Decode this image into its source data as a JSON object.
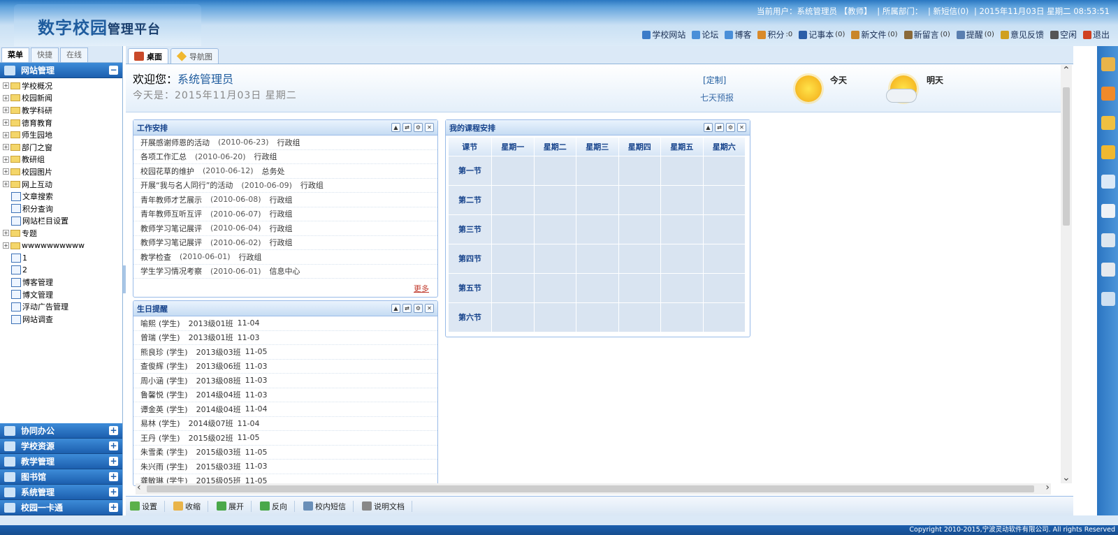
{
  "header": {
    "logo_main": "数字校园",
    "logo_sub": "管理平台",
    "user_label": "当前用户：系统管理员 【教师】",
    "dept_label": "| 所属部门：",
    "sms_label": "| 新短信(0)",
    "datetime": "| 2015年11月03日 星期二 08:53:51",
    "toolbar": [
      {
        "label": "学校网站",
        "count": "",
        "icon": "website-icon",
        "color": "#3b7bc8"
      },
      {
        "label": "论坛",
        "count": "",
        "icon": "forum-icon",
        "color": "#4a8fd8"
      },
      {
        "label": "博客",
        "count": "",
        "icon": "blog-icon",
        "color": "#4a8fd8"
      },
      {
        "label": "积分",
        "count": ":0",
        "icon": "points-icon",
        "color": "#d98a2a"
      },
      {
        "label": "记事本",
        "count": "(0)",
        "icon": "notebook-icon",
        "color": "#2a5ea8"
      },
      {
        "label": "新文件",
        "count": "(0)",
        "icon": "file-icon",
        "color": "#c9862a"
      },
      {
        "label": "新留言",
        "count": "(0)",
        "icon": "message-icon",
        "color": "#8a6a3a"
      },
      {
        "label": "提醒",
        "count": "(0)",
        "icon": "reminder-icon",
        "color": "#5a7fb0"
      },
      {
        "label": "意见反馈",
        "count": "",
        "icon": "feedback-icon",
        "color": "#d0a020"
      },
      {
        "label": "空闲",
        "count": "",
        "icon": "idle-icon",
        "color": "#555"
      },
      {
        "label": "退出",
        "count": "",
        "icon": "logout-icon",
        "color": "#d04020"
      }
    ]
  },
  "left": {
    "tabs": [
      "菜单",
      "快捷",
      "在线"
    ],
    "section_top": "网站管理",
    "tree": [
      {
        "label": "学校概况",
        "type": "folder"
      },
      {
        "label": "校园新闻",
        "type": "folder"
      },
      {
        "label": "教学科研",
        "type": "folder"
      },
      {
        "label": "德育教育",
        "type": "folder"
      },
      {
        "label": "师生园地",
        "type": "folder"
      },
      {
        "label": "部门之窗",
        "type": "folder"
      },
      {
        "label": "教研组",
        "type": "folder"
      },
      {
        "label": "校园图片",
        "type": "folder"
      },
      {
        "label": "网上互动",
        "type": "folder"
      },
      {
        "label": "文章搜索",
        "type": "doc"
      },
      {
        "label": "积分查询",
        "type": "doc"
      },
      {
        "label": "网站栏目设置",
        "type": "doc"
      },
      {
        "label": "专题",
        "type": "folder"
      },
      {
        "label": "wwwwwwwwww",
        "type": "folder"
      },
      {
        "label": "1",
        "type": "doc"
      },
      {
        "label": "2",
        "type": "doc"
      },
      {
        "label": "博客管理",
        "type": "doc"
      },
      {
        "label": "博文管理",
        "type": "doc"
      },
      {
        "label": "浮动广告管理",
        "type": "doc"
      },
      {
        "label": "网站调查",
        "type": "doc"
      }
    ],
    "sections_bottom": [
      "协同办公",
      "学校资源",
      "教学管理",
      "图书馆",
      "系统管理",
      "校园一卡通"
    ]
  },
  "main": {
    "tabs": [
      "桌面",
      "导航图"
    ],
    "welcome_prefix": "欢迎您：",
    "welcome_name": "系统管理员",
    "today_text": "今天是：2015年11月03日 星期二",
    "custom": "[定制]",
    "forecast": "七天预报",
    "today": "今天",
    "tomorrow": "明天",
    "work": {
      "title": "工作安排",
      "more": "更多",
      "rows": [
        {
          "title": "开展感谢师恩的活动",
          "date": "(2010-06-23)",
          "dept": "行政组"
        },
        {
          "title": "各项工作汇总",
          "date": "(2010-06-20)",
          "dept": "行政组"
        },
        {
          "title": "校园花草的维护",
          "date": "(2010-06-12)",
          "dept": "总务处"
        },
        {
          "title": "开展“我与名人同行”的活动",
          "date": "(2010-06-09)",
          "dept": "行政组"
        },
        {
          "title": "青年教师才艺展示",
          "date": "(2010-06-08)",
          "dept": "行政组"
        },
        {
          "title": "青年教师互听互评",
          "date": "(2010-06-07)",
          "dept": "行政组"
        },
        {
          "title": "教师学习笔记展评",
          "date": "(2010-06-04)",
          "dept": "行政组"
        },
        {
          "title": "教师学习笔记展评",
          "date": "(2010-06-02)",
          "dept": "行政组"
        },
        {
          "title": "教学检查",
          "date": "(2010-06-01)",
          "dept": "行政组"
        },
        {
          "title": "学生学习情况考察",
          "date": "(2010-06-01)",
          "dept": "信息中心"
        }
      ]
    },
    "birthday": {
      "title": "生日提醒",
      "rows": [
        {
          "name": "喻熙",
          "role": "(学生)",
          "cls": "2013级01班",
          "date": "11-04"
        },
        {
          "name": "曾瑞",
          "role": "(学生)",
          "cls": "2013级01班",
          "date": "11-03"
        },
        {
          "name": "熊良珍",
          "role": "(学生)",
          "cls": "2013级03班",
          "date": "11-05"
        },
        {
          "name": "查俊辉",
          "role": "(学生)",
          "cls": "2013级06班",
          "date": "11-03"
        },
        {
          "name": "周小涵",
          "role": "(学生)",
          "cls": "2013级08班",
          "date": "11-03"
        },
        {
          "name": "鲁馨悦",
          "role": "(学生)",
          "cls": "2014级04班",
          "date": "11-03"
        },
        {
          "name": "谭金英",
          "role": "(学生)",
          "cls": "2014级04班",
          "date": "11-04"
        },
        {
          "name": "易林",
          "role": "(学生)",
          "cls": "2014级07班",
          "date": "11-04"
        },
        {
          "name": "王丹",
          "role": "(学生)",
          "cls": "2015级02班",
          "date": "11-05"
        },
        {
          "name": "朱雪柔",
          "role": "(学生)",
          "cls": "2015级03班",
          "date": "11-05"
        },
        {
          "name": "朱兴雨",
          "role": "(学生)",
          "cls": "2015级03班",
          "date": "11-03"
        },
        {
          "name": "龚敏琳",
          "role": "(学生)",
          "cls": "2015级05班",
          "date": "11-05"
        }
      ]
    },
    "schedule": {
      "title": "我的课程安排",
      "headers": [
        "课节",
        "星期一",
        "星期二",
        "星期三",
        "星期四",
        "星期五",
        "星期六"
      ],
      "periods": [
        "第一节",
        "第二节",
        "第三节",
        "第四节",
        "第五节",
        "第六节"
      ]
    },
    "bottombar": [
      "设置",
      "收缩",
      "展开",
      "反向",
      "校内短信",
      "说明文档"
    ]
  },
  "footer": "Copyright 2010-2015,宁波灵动软件有限公司. All rights Reserved"
}
